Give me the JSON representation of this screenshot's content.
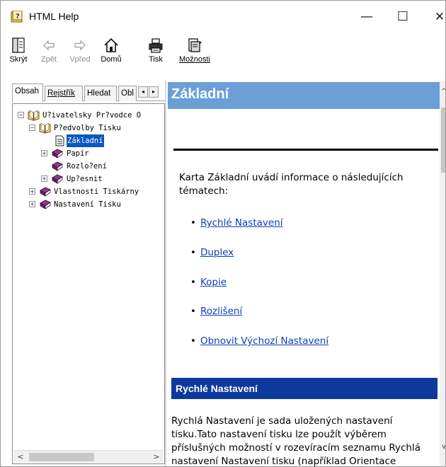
{
  "window": {
    "title": "HTML Help",
    "controls": {
      "minimize": "—",
      "maximize": "☐",
      "close": "✕"
    }
  },
  "toolbar": {
    "hide": "Skrýt",
    "back": "Zpět",
    "forward": "Vpřed",
    "home": "Domů",
    "print": "Tisk",
    "options": "Možnosti"
  },
  "nav": {
    "tabs": [
      "Obsah",
      "Rejstřík",
      "Hledat",
      "Obl"
    ],
    "tab_scroll_left": "◂",
    "tab_scroll_right": "▸",
    "tree": [
      {
        "label": "U?ivatelsky Pr?vodce O",
        "expander": "−"
      },
      {
        "label": "P?edvolby Tisku",
        "expander": "−"
      },
      {
        "label": "Základní"
      },
      {
        "label": "Papír",
        "expander": "+"
      },
      {
        "label": "Rozlo?ení"
      },
      {
        "label": "Up?esnit",
        "expander": "+"
      },
      {
        "label": "Vlastnosti Tiskárny",
        "expander": "+"
      },
      {
        "label": "Nastavení Tisku",
        "expander": "+"
      }
    ],
    "scroll_left": "<",
    "scroll_right": ">"
  },
  "content": {
    "header": "Základní",
    "intro": "Karta Základní uvádí informace o následujících tématech:",
    "links": [
      "Rychlé Nastavení",
      "Duplex",
      "Kopie",
      "Rozlišení",
      "Obnovit Výchozí Nastavení"
    ],
    "bullet": "•",
    "section_title": "Rychlé Nastavení",
    "section_text": "Rychlá Nastavení je sada uložených nastavení tisku.Tato nastavení tisku lze použít výběrem příslušných možností v rozevíracím seznamu Rychlá nastavení Nastavení tisku (například Orientace",
    "scroll_up": "^",
    "scroll_down": "v"
  },
  "colors": {
    "header_bg": "#6b9fd6",
    "section_bg": "#0b3a9c",
    "link": "#0b3fbd",
    "selection": "#0a57c2",
    "book_purple": "#7b2a7a"
  }
}
